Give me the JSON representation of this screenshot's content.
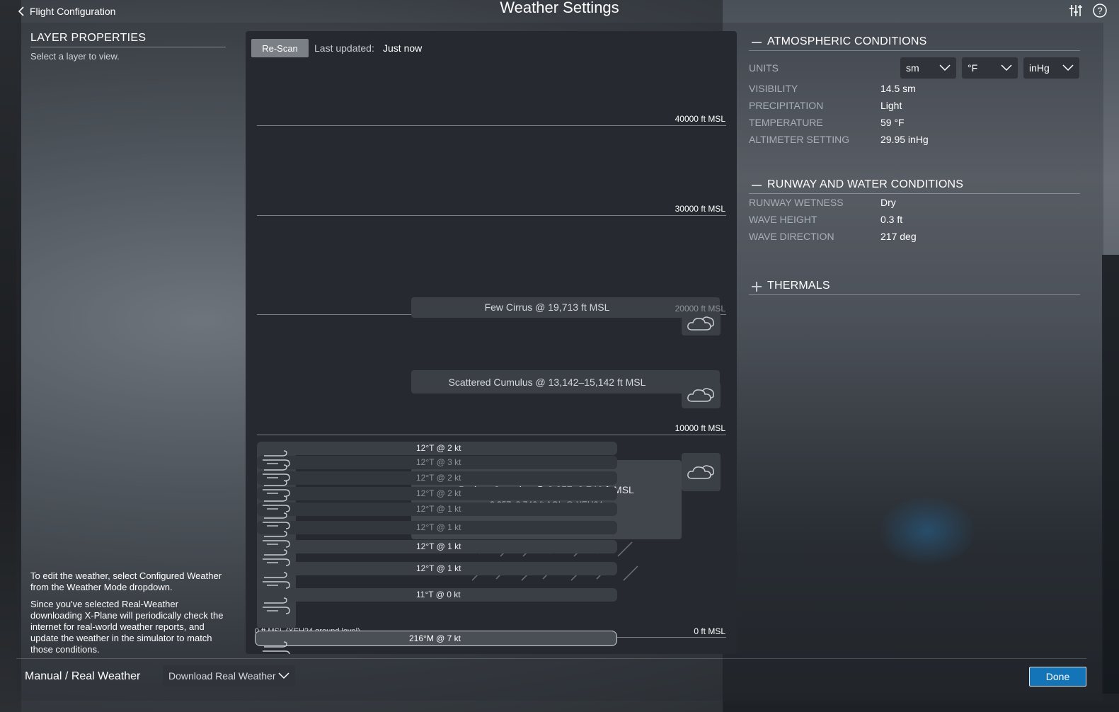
{
  "header": {
    "back_label": "Flight Configuration",
    "title": "Weather Settings",
    "icons": [
      "sliders-icon",
      "help-icon"
    ]
  },
  "left_panel": {
    "title": "LAYER PROPERTIES",
    "subtitle": "Select a layer to view.",
    "note1": "To edit the weather, select Configured Weather from the Weather Mode dropdown.",
    "note2": "Since you've selected Real-Weather downloading X-Plane will periodically check the internet for real-world weather reports, and update the weather in the simulator to match those conditions."
  },
  "center": {
    "rescan_label": "Re-Scan",
    "last_updated_label": "Last updated:",
    "last_updated_value": "Just now",
    "altitudes": [
      "40000 ft MSL",
      "30000 ft MSL",
      "20000 ft MSL",
      "10000 ft MSL",
      "0 ft MSL"
    ],
    "ground_label": "0 ft MSL (XEH24 ground level)",
    "layers": {
      "cirrus": "Few Cirrus @ 19,713 ft MSL",
      "scattered": "Scattered Cumulus @ 13,142–15,142 ft MSL",
      "broken": "Broken Cumulus @ 3,357–8,746 ft MSL",
      "broken_sub": "3,357–8,746 ft AGL @ XEH24"
    },
    "winds": [
      "12°T @ 2 kt",
      "12°T @ 3 kt",
      "12°T @ 2 kt",
      "12°T @ 2 kt",
      "12°T @ 1 kt",
      "12°T @ 1 kt",
      "12°T @ 1 kt",
      "12°T @ 1 kt",
      "11°T @ 0 kt"
    ],
    "surface_wind": "216°M @ 7 kt"
  },
  "atmospheric": {
    "title": "ATMOSPHERIC CONDITIONS",
    "units_label": "UNITS",
    "unit_distance": "sm",
    "unit_temp": "°F",
    "unit_pressure": "inHg",
    "visibility_label": "VISIBILITY",
    "visibility": "14.5 sm",
    "precip_label": "PRECIPITATION",
    "precip": "Light",
    "temp_label": "TEMPERATURE",
    "temp": "59 °F",
    "altimeter_label": "ALTIMETER SETTING",
    "altimeter": "29.95 inHg"
  },
  "runway": {
    "title": "RUNWAY AND WATER CONDITIONS",
    "wetness_label": "RUNWAY WETNESS",
    "wetness": "Dry",
    "wave_height_label": "WAVE HEIGHT",
    "wave_height": "0.3 ft",
    "wave_dir_label": "WAVE DIRECTION",
    "wave_dir": "217 deg"
  },
  "thermals": {
    "title": "THERMALS"
  },
  "footer": {
    "mode_label": "Manual / Real Weather",
    "mode_value": "Download Real Weather",
    "done_label": "Done"
  },
  "colors": {
    "accent": "#1474b8",
    "panel": "#262a30",
    "layer": "#3b4047"
  }
}
